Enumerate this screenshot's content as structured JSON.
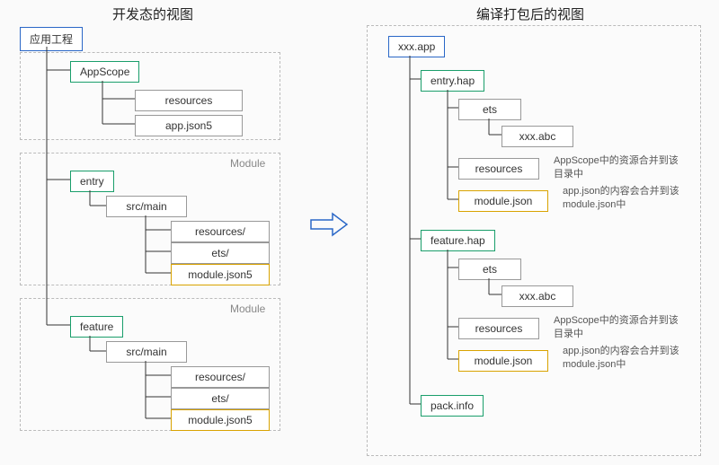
{
  "titles": {
    "left": "开发态的视图",
    "right": "编译打包后的视图"
  },
  "left": {
    "root": "应用工程",
    "appscope": {
      "label": "AppScope",
      "children": {
        "resources": "resources",
        "appjson5": "app.json5"
      }
    },
    "module_label": "Module",
    "entry": {
      "label": "entry",
      "srcmain": "src/main",
      "children": {
        "resources": "resources/",
        "ets": "ets/",
        "modulejson5": "module.json5"
      }
    },
    "feature": {
      "label": "feature",
      "srcmain": "src/main",
      "children": {
        "resources": "resources/",
        "ets": "ets/",
        "modulejson5": "module.json5"
      }
    }
  },
  "right": {
    "root": "xxx.app",
    "entryhap": {
      "label": "entry.hap",
      "ets": "ets",
      "abc": "xxx.abc",
      "resources": "resources",
      "modulejson": "module.json"
    },
    "featurehap": {
      "label": "feature.hap",
      "ets": "ets",
      "abc": "xxx.abc",
      "resources": "resources",
      "modulejson": "module.json"
    },
    "packinfo": "pack.info",
    "notes": {
      "resources": "AppScope中的资源合并到该目录中",
      "modulejson": "app.json的内容会合并到该module.json中"
    }
  },
  "arrow_glyph": "⇨"
}
